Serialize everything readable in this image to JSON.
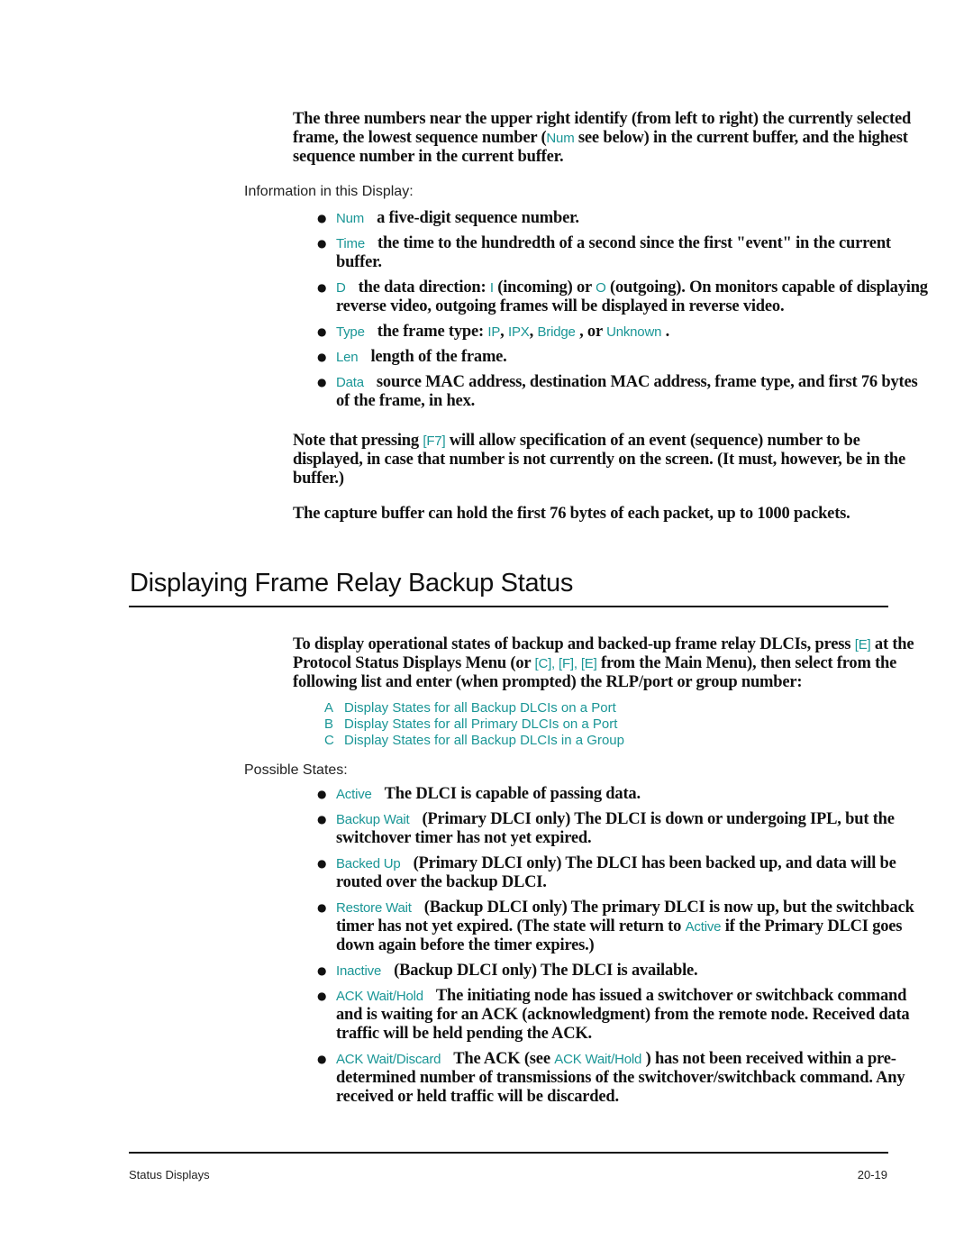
{
  "intro": {
    "p1_a": "The three numbers near the upper right identify (from left to right) the currently selected frame, the lowest sequence number (",
    "p1_term": "Num",
    "p1_b": " see below) in the current buffer, and the highest sequence number in the current buffer."
  },
  "info_label": "Information in this Display:",
  "info_items": [
    {
      "term": "Num",
      "desc": "a five-digit sequence number."
    },
    {
      "term": "Time",
      "desc": "the time to the hundredth of a second since the first \"event\" in the current buffer."
    },
    {
      "term": "D",
      "desc_a": "the data direction: ",
      "code_i": "I",
      "desc_b": " (incoming) or ",
      "code_o": "O",
      "desc_c": " (outgoing). On monitors capable of displaying reverse video, outgoing frames will be displayed in reverse video."
    },
    {
      "term": "Type",
      "desc_a": "the frame type: ",
      "t1": "IP",
      "t2": "IPX",
      "t3": "Bridge",
      "desc_or": " , or ",
      "t4": "Unknown",
      "desc_end": " ."
    },
    {
      "term": "Len",
      "desc": "length of the frame."
    },
    {
      "term": "Data",
      "desc": "source MAC address, destination MAC address, frame type, and first 76 bytes of the frame, in hex."
    }
  ],
  "note": {
    "a": "Note that pressing ",
    "key": "[F7]",
    "b": " will allow specification of an event (sequence) number to be displayed, in case that number is not currently on the screen. (It must, however, be in the buffer.)"
  },
  "capture_text": "The capture buffer can hold the first 76 bytes of each packet, up to 1000 packets.",
  "section": {
    "heading": "Displaying Frame Relay Backup Status",
    "p_a": "To display operational states of backup and backed-up frame relay DLCIs, press ",
    "key1": "[E]",
    "p_b": " at the Protocol Status Displays Menu (or ",
    "key2": "[C], [F], [E]",
    "p_c": " from the Main Menu), then select from the following list and enter (when prompted) the RLP/port or group number:",
    "options": [
      {
        "key": "A",
        "label": "Display States for all Backup DLCIs on a Port"
      },
      {
        "key": "B",
        "label": "Display States for all Primary DLCIs on a Port"
      },
      {
        "key": "C",
        "label": "Display States for all Backup DLCIs in a Group"
      }
    ],
    "states_label": "Possible States:",
    "states": [
      {
        "term": "Active",
        "desc": "The DLCI is capable of passing data."
      },
      {
        "term": "Backup Wait",
        "desc": "(Primary DLCI only) The DLCI is down or undergoing IPL, but the switchover timer has not yet expired."
      },
      {
        "term": "Backed Up",
        "desc": "(Primary DLCI only) The DLCI has been backed up, and data will be routed over the backup DLCI."
      },
      {
        "term": "Restore Wait",
        "desc_a": "(Backup DLCI only) The primary DLCI is now up, but the switchback timer has not yet expired. (The state will return to ",
        "ref": "Active",
        "desc_b": " if the Primary DLCI goes down again before the timer expires.)"
      },
      {
        "term": "Inactive",
        "desc": "(Backup DLCI only) The DLCI is available."
      },
      {
        "term": "ACK Wait/Hold",
        "desc": "The initiating node has issued a switchover or switchback command and is waiting for an ACK (acknowledgment) from the remote node. Received data traffic will be held pending the ACK."
      },
      {
        "term": "ACK Wait/Discard",
        "desc_a": "The ACK (see ",
        "ref": "ACK Wait/Hold",
        "desc_b": " ) has not been received within a pre-determined number of transmissions of the switchover/switchback command. Any received or held traffic will be discarded."
      }
    ]
  },
  "footer": {
    "section": "Status Displays",
    "page": "20-19"
  },
  "colors": {
    "accent": "#1a9696",
    "text": "#111111"
  }
}
